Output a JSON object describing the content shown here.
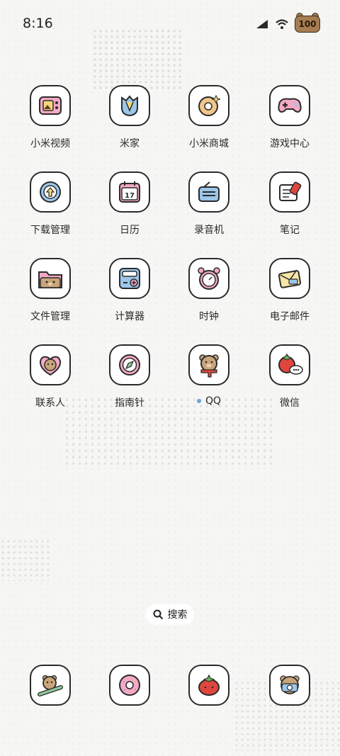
{
  "status": {
    "time": "8:16",
    "battery": "100"
  },
  "apps": [
    {
      "label": "小米视频"
    },
    {
      "label": "米家"
    },
    {
      "label": "小米商城"
    },
    {
      "label": "游戏中心"
    },
    {
      "label": "下载管理"
    },
    {
      "label": "日历"
    },
    {
      "label": "录音机"
    },
    {
      "label": "笔记"
    },
    {
      "label": "文件管理"
    },
    {
      "label": "计算器"
    },
    {
      "label": "时钟"
    },
    {
      "label": "电子邮件"
    },
    {
      "label": "联系人"
    },
    {
      "label": "指南针"
    },
    {
      "label": "QQ"
    },
    {
      "label": "微信"
    }
  ],
  "calendar": {
    "day": "17"
  },
  "search": {
    "label": "搜索"
  },
  "colors": {
    "pink": "#f4a9c4",
    "blue": "#9cc7ea",
    "tan": "#c9a57a",
    "red": "#e0463d"
  }
}
